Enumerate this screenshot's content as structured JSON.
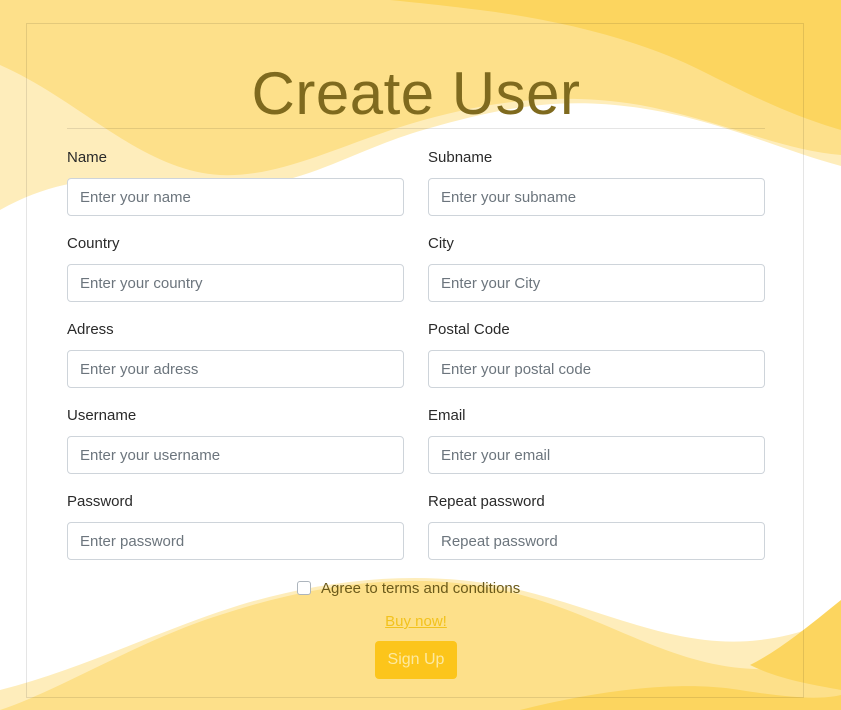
{
  "page": {
    "title": "Create User"
  },
  "form": {
    "fields": {
      "name": {
        "label": "Name",
        "placeholder": "Enter your name",
        "value": ""
      },
      "subname": {
        "label": "Subname",
        "placeholder": "Enter your subname",
        "value": ""
      },
      "country": {
        "label": "Country",
        "placeholder": "Enter your country",
        "value": ""
      },
      "city": {
        "label": "City",
        "placeholder": "Enter your City",
        "value": ""
      },
      "adress": {
        "label": "Adress",
        "placeholder": "Enter your adress",
        "value": ""
      },
      "postal_code": {
        "label": "Postal Code",
        "placeholder": "Enter your postal code",
        "value": ""
      },
      "username": {
        "label": "Username",
        "placeholder": "Enter your username",
        "value": ""
      },
      "email": {
        "label": "Email",
        "placeholder": "Enter your email",
        "value": ""
      },
      "password": {
        "label": "Password",
        "placeholder": "Enter password",
        "value": ""
      },
      "repeat_password": {
        "label": "Repeat password",
        "placeholder": "Repeat password",
        "value": ""
      }
    },
    "agree": {
      "label": "Agree to terms and conditions",
      "checked": false
    },
    "buy_link": "Buy now!",
    "submit_label": "Sign Up"
  },
  "colors": {
    "wave_dark": "#fcd55f",
    "wave_mid": "#fde08a",
    "wave_light": "#feedbb",
    "title": "#7f6a1e",
    "button": "#fcc51b",
    "link": "#f2c21d"
  }
}
